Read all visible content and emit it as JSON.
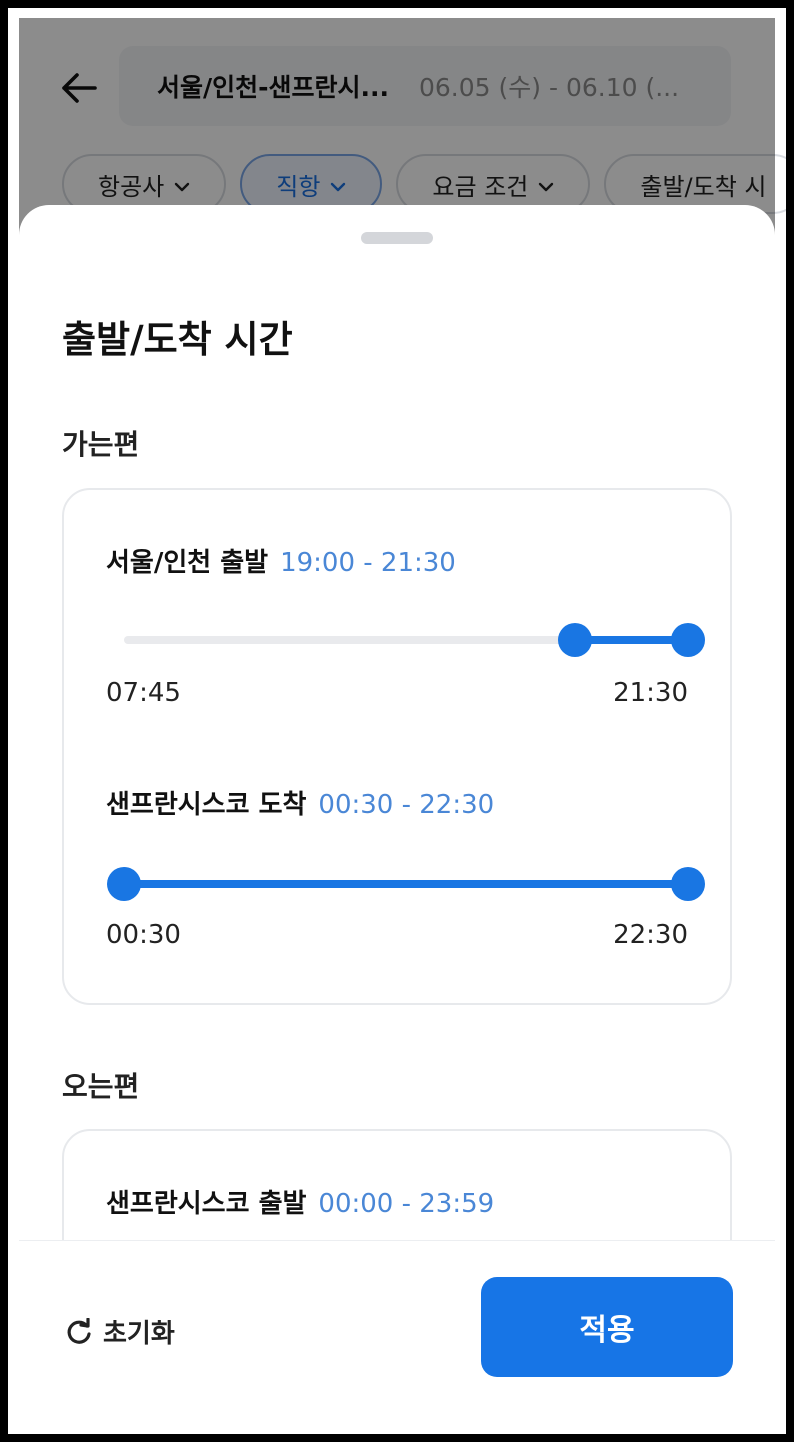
{
  "header": {
    "route": "서울/인천-샌프란시...",
    "dates": "06.05 (수) - 06.10 (..."
  },
  "filters": [
    {
      "label": "항공사"
    },
    {
      "label": "직항"
    },
    {
      "label": "요금 조건"
    },
    {
      "label": "출발/도착 시"
    }
  ],
  "sheet": {
    "title": "출발/도착 시간",
    "outbound": {
      "label": "가는편",
      "departure": {
        "title": "서울/인천 출발",
        "range": "19:00 - 21:30",
        "min_label": "07:45",
        "max_label": "21:30",
        "start_fraction": 0.8,
        "end_fraction": 1.0
      },
      "arrival": {
        "title": "샌프란시스코 도착",
        "range": "00:30 - 22:30",
        "min_label": "00:30",
        "max_label": "22:30",
        "start_fraction": 0.0,
        "end_fraction": 1.0
      }
    },
    "return": {
      "label": "오는편",
      "departure": {
        "title": "샌프란시스코 출발",
        "range": "00:00 - 23:59"
      }
    },
    "reset_label": "초기화",
    "apply_label": "적용"
  },
  "colors": {
    "accent": "#1976e3",
    "range_text": "#4a87d6"
  }
}
